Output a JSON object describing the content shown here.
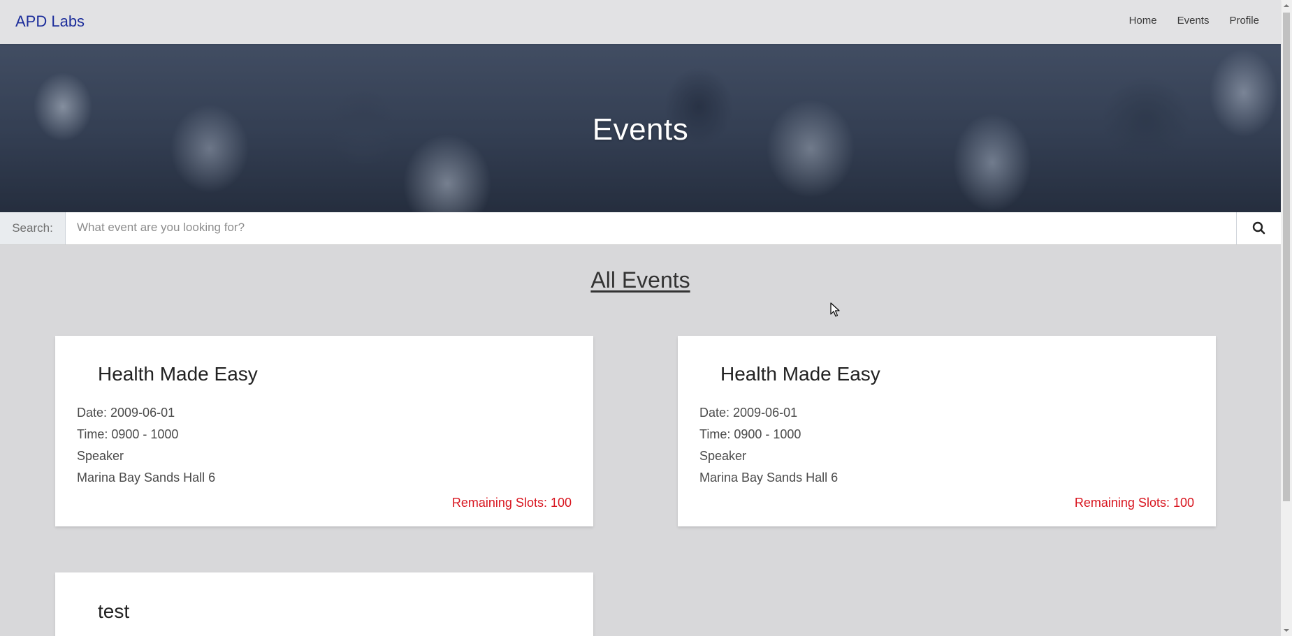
{
  "navbar": {
    "brand": "APD Labs",
    "links": [
      "Home",
      "Events",
      "Profile"
    ]
  },
  "hero": {
    "title": "Events"
  },
  "search": {
    "label": "Search:",
    "placeholder": "What event are you looking for?",
    "value": "",
    "button_icon": "search-icon"
  },
  "section": {
    "title": "All Events"
  },
  "events": [
    {
      "title": "Health Made Easy",
      "date": "Date: 2009-06-01",
      "time": "Time: 0900 - 1000",
      "speaker": "Speaker",
      "venue": "Marina Bay Sands Hall 6",
      "slots": "Remaining Slots: 100"
    },
    {
      "title": "Health Made Easy",
      "date": "Date: 2009-06-01",
      "time": "Time: 0900 - 1000",
      "speaker": "Speaker",
      "venue": "Marina Bay Sands Hall 6",
      "slots": "Remaining Slots: 100"
    },
    {
      "title": "test"
    }
  ],
  "colors": {
    "brand": "#1d2e9b",
    "slots": "#d8151f",
    "background": "#d8d8da"
  }
}
